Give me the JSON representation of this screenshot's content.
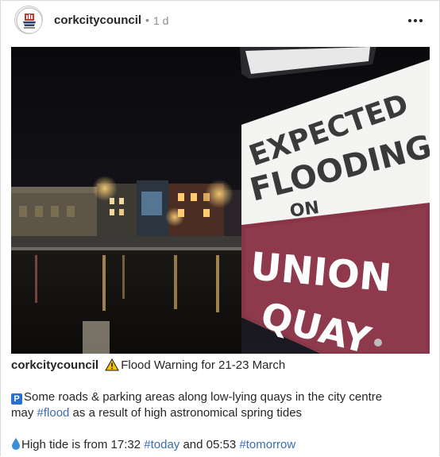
{
  "post": {
    "username": "corkcitycouncil",
    "separator": "•",
    "time": "1 d",
    "more_icon": "more-horizontal-icon",
    "photo_sign": {
      "line1": "EXPECTED",
      "line2": "FLOODING",
      "line3": "ON",
      "line4": "UNION",
      "line5": "QUAY"
    },
    "caption": {
      "username": "corkcitycouncil",
      "title": "Flood Warning for 21-23 March",
      "para1_a": "Some roads & parking areas along low-lying quays in the city centre",
      "para1_b_pre": "may ",
      "para1_tag": "#flood",
      "para1_b_post": " as a result of high astronomical spring tides",
      "para2_pre": "High tide is from 17:32 ",
      "para2_tag1": "#today",
      "para2_mid": " and 05:53 ",
      "para2_tag2": "#tomorrow"
    }
  }
}
